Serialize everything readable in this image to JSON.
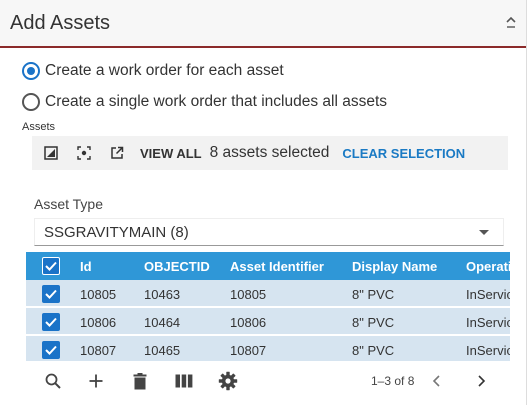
{
  "panel": {
    "title": "Add Assets",
    "collapse_icon": "chevron-up-icon"
  },
  "options": {
    "each": "Create a work order for each asset",
    "single": "Create a single work order that includes all assets",
    "selected": "each"
  },
  "assets": {
    "label": "Assets",
    "toolbar": {
      "icons": [
        "map-select-icon",
        "zoom-to-selection-icon",
        "open-external-icon"
      ],
      "view_all": "VIEW ALL",
      "selected_count": "8 assets selected",
      "clear_selection": "CLEAR SELECTION"
    },
    "asset_type_label": "Asset Type",
    "asset_type_value": "SSGRAVITYMAIN (8)"
  },
  "grid": {
    "columns": [
      "Id",
      "OBJECTID",
      "Asset Identifier",
      "Display Name",
      "OperationalStatus"
    ],
    "rows": [
      [
        "10805",
        "10463",
        "10805",
        "8\" PVC",
        "InService"
      ],
      [
        "10806",
        "10464",
        "10806",
        "8\" PVC",
        "InService"
      ],
      [
        "10807",
        "10465",
        "10807",
        "8\" PVC",
        "InService"
      ]
    ],
    "all_checked": true
  },
  "footer": {
    "icons": [
      "search-icon",
      "add-icon",
      "delete-icon",
      "columns-icon",
      "settings-icon"
    ],
    "pager_text": "1–3 of 8"
  },
  "colors": {
    "accent": "#1a73c8",
    "header_row": "#2f97d7",
    "row_bg": "#d6e4f0",
    "header_border": "#8b2a2a"
  }
}
